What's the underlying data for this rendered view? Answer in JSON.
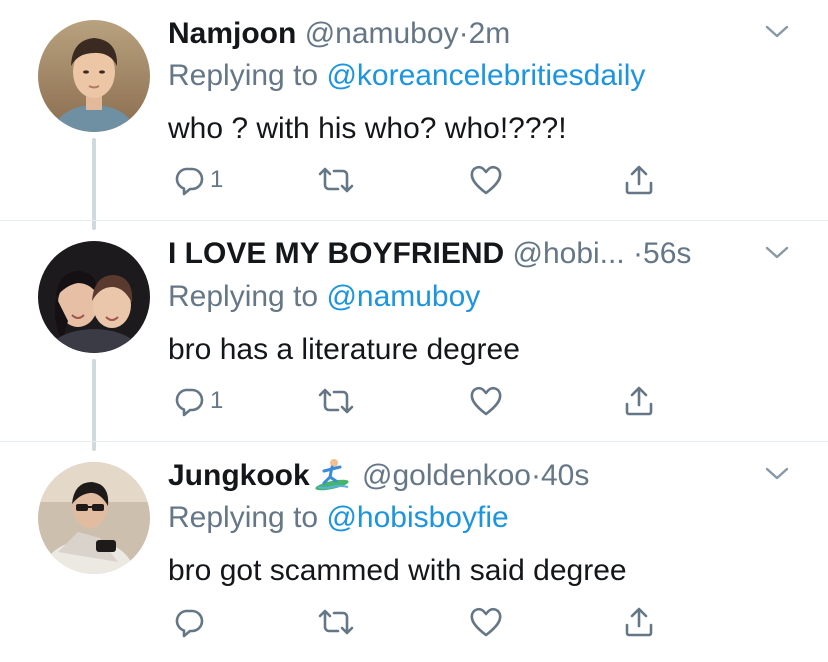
{
  "tweets": [
    {
      "display_name": "Namjoon",
      "handle": "@namuboy",
      "separator": "·",
      "time": "2m",
      "replying_prefix": "Replying to",
      "replying_to": "@koreancelebritiesdaily",
      "text": "who ? with his who? who!???!",
      "reply_count": "1"
    },
    {
      "display_name": "I LOVE MY BOYFRIEND",
      "handle": "@hobi...",
      "separator": "·",
      "time": "56s",
      "replying_prefix": "Replying to",
      "replying_to": "@namuboy",
      "text": "bro has a literature degree",
      "reply_count": "1"
    },
    {
      "display_name": "Jungkook",
      "handle": "@goldenkoo",
      "separator": "·",
      "time": "40s",
      "replying_prefix": "Replying to",
      "replying_to": "@hobisboyfie",
      "text": "bro got scammed with said degree",
      "reply_count": ""
    }
  ],
  "icons": {
    "reply": "reply-icon",
    "retweet": "retweet-icon",
    "like": "like-icon",
    "share": "share-icon",
    "more": "chevron-down-icon",
    "name_emoji": "surfer-emoji-icon"
  },
  "colors": {
    "text": "#14171a",
    "secondary": "#657786",
    "link": "#1b95e0",
    "thread_line": "#cfd9de",
    "divider": "#e6ecf0"
  }
}
